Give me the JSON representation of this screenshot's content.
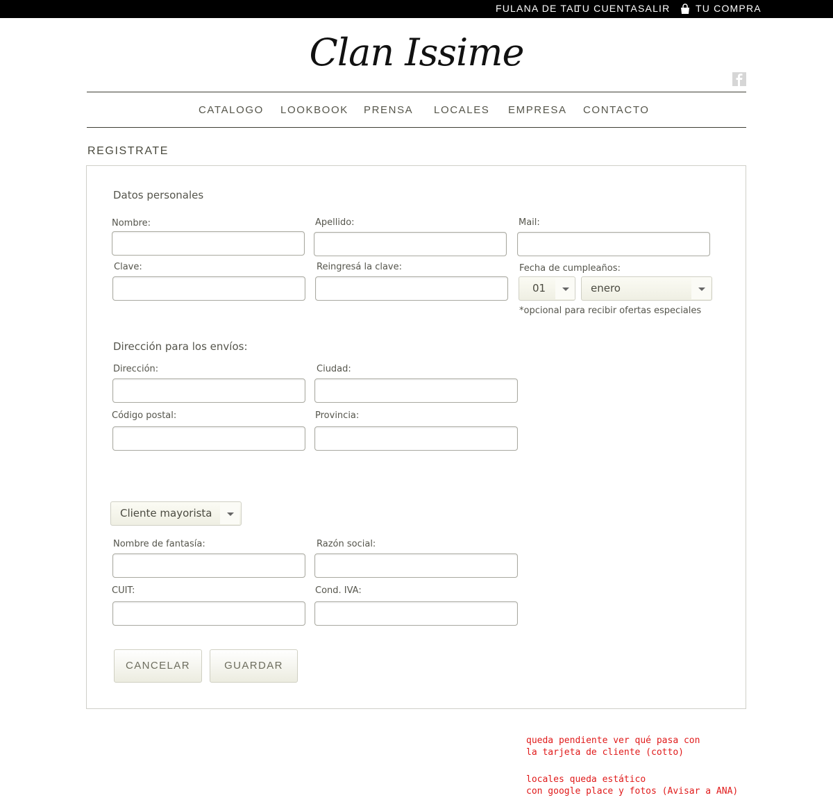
{
  "topbar": {
    "user": "FULANA DE TAL",
    "account": "TU CUENTA",
    "logout": "SALIR",
    "cart": "TU COMPRA"
  },
  "logo": "Clan Issime",
  "nav": {
    "items": [
      "CATALOGO",
      "LOOKBOOK",
      "PRENSA",
      "LOCALES",
      "EMPRESA",
      "CONTACTO"
    ]
  },
  "page_title": "REGISTRATE",
  "personal": {
    "title": "Datos personales",
    "nombre": "Nombre:",
    "apellido": "Apellido:",
    "mail": "Mail:",
    "clave": "Clave:",
    "reclave": "Reingresá la clave:",
    "birthday_label": "Fecha de cumpleaños:",
    "day": "01",
    "month": "enero",
    "birthday_hint": "*opcional para recibir ofertas especiales"
  },
  "shipping": {
    "title": "Dirección para los envíos:",
    "direccion": "Dirección:",
    "ciudad": "Ciudad:",
    "cp": "Código postal:",
    "provincia": "Provincia:"
  },
  "wholesale": {
    "client_type": "Cliente mayorista",
    "fantasia": "Nombre de fantasía:",
    "razon": "Razón social:",
    "cuit": "CUIT:",
    "iva": "Cond. IVA:"
  },
  "buttons": {
    "cancel": "CANCELAR",
    "save": "GUARDAR"
  },
  "notes": {
    "line1": "queda pendiente ver qué pasa con",
    "line2": "la tarjeta de cliente (cotto)",
    "line3": "locales queda estático",
    "line4": "con google place y fotos (Avisar a ANA)"
  },
  "colors": {
    "topbar": "#000000",
    "note_red": "#e01a1a",
    "text": "#55554c"
  }
}
